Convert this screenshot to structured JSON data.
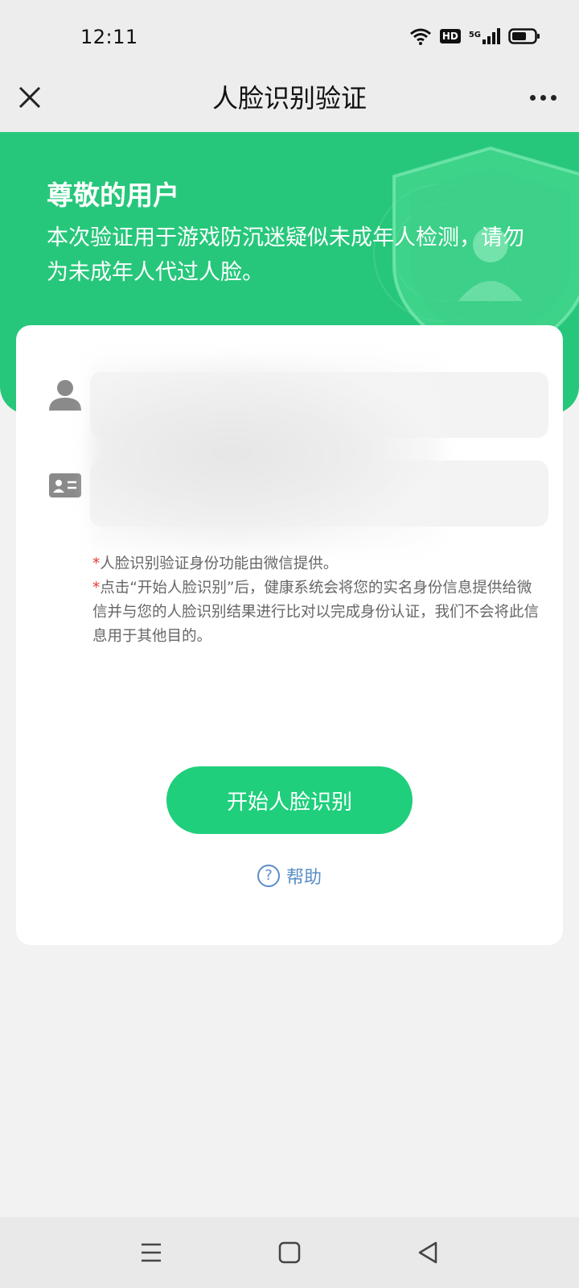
{
  "status_bar": {
    "time": "12:11",
    "icons": [
      "wifi-icon",
      "hd-icon",
      "signal-5g-icon",
      "battery-icon"
    ],
    "hd_label": "HD",
    "network_label": "5G"
  },
  "nav": {
    "title": "人脸识别验证",
    "close_icon": "close-icon",
    "more_icon": "more-icon"
  },
  "hero": {
    "greeting": "尊敬的用户",
    "description": "本次验证用于游戏防沉迷疑似未成年人检测，请勿为未成年人代过人脸。",
    "background_color": "#27c77b"
  },
  "form": {
    "name_value": "",
    "id_value": ""
  },
  "notes": {
    "line1_star": "*",
    "line1": "人脸识别验证身份功能由微信提供。",
    "line2_star": "*",
    "line2": "点击“开始人脸识别”后，健康系统会将您的实名身份信息提供给微信并与您的人脸识别结果进行比对以完成身份认证，我们不会将此信息用于其他目的。"
  },
  "actions": {
    "start_label": "开始人脸识别",
    "help_label": "帮助",
    "accent_color": "#1fcf7c",
    "link_color": "#5a8ec7"
  },
  "system_nav": {
    "icons": [
      "menu-icon",
      "home-icon",
      "back-icon"
    ]
  }
}
